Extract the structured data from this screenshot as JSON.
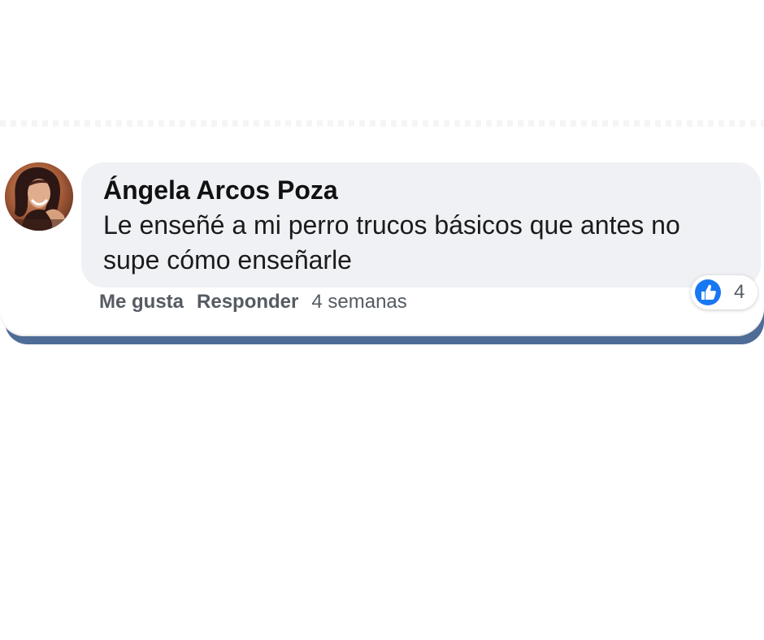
{
  "comment": {
    "author": "Ángela Arcos Poza",
    "text": "Le enseñé a mi perro trucos básicos que antes no supe cómo enseñarle",
    "actions": {
      "like_label": "Me gusta",
      "reply_label": "Responder",
      "timestamp": "4 semanas"
    },
    "reaction": {
      "icon": "thumbs-up-icon",
      "count": "4",
      "color": "#1877f2"
    }
  },
  "colors": {
    "bubble_background": "#f0f1f4",
    "action_text": "#555b62",
    "card_border": "#4f6c96"
  }
}
